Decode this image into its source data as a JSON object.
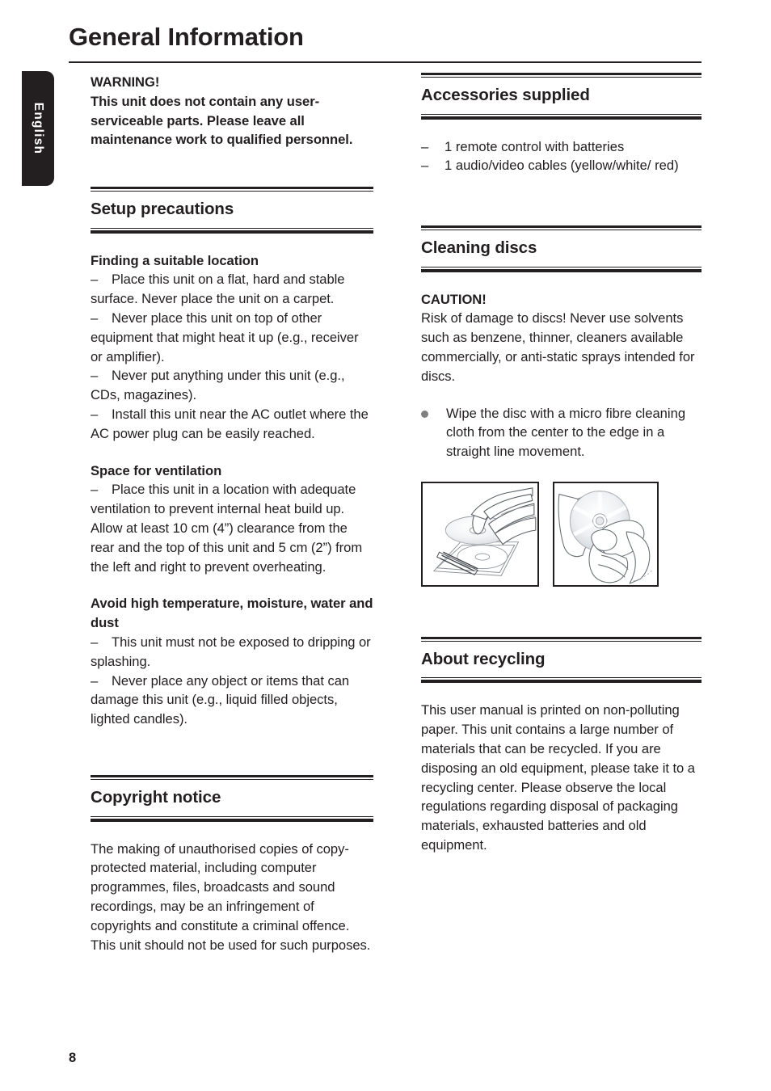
{
  "page": {
    "title": "General Information",
    "number": "8",
    "language_tab": "English"
  },
  "left_column": {
    "warning": {
      "heading": "WARNING!",
      "text": "This unit does not contain any user-serviceable parts. Please leave all maintenance work to qualified personnel."
    },
    "setup_precautions": {
      "title": "Setup precautions",
      "subsections": [
        {
          "heading": "Finding a suitable location",
          "items": [
            "Place this unit on a flat, hard and stable surface. Never place the unit on a carpet.",
            "Never place this unit on top of other equipment that might heat it up (e.g., receiver or amplifier).",
            "Never put anything under this unit (e.g., CDs, magazines).",
            "Install this unit near the AC outlet where the AC power plug can be easily reached."
          ]
        },
        {
          "heading": "Space for ventilation",
          "items": [
            "Place this unit in a location with adequate ventilation to prevent internal heat build up. Allow at least 10 cm (4”) clearance from the rear and the top of this unit and 5 cm (2”) from the left and right to prevent overheating."
          ]
        },
        {
          "heading": "Avoid high temperature, moisture, water and dust",
          "items": [
            "This unit must not be exposed to dripping or splashing.",
            "Never place any object or items that can damage this unit (e.g., liquid filled objects, lighted candles)."
          ]
        }
      ]
    },
    "copyright_notice": {
      "title": "Copyright notice",
      "text": "The making of unauthorised copies of copy-protected material, including computer programmes, files, broadcasts and sound recordings, may be an infringement of copyrights and constitute a criminal offence. This unit should not be used for such purposes."
    }
  },
  "right_column": {
    "accessories_supplied": {
      "title": "Accessories supplied",
      "items": [
        "1 remote control with batteries",
        "1 audio/video cables (yellow/white/ red)"
      ]
    },
    "cleaning_discs": {
      "title": "Cleaning discs",
      "caution_heading": "CAUTION!",
      "caution_text": "Risk of damage to discs! Never use solvents such as benzene, thinner, cleaners available commercially, or anti-static sprays intended for discs.",
      "bullet": "Wipe the disc with a micro fibre cleaning cloth from the center to the edge in a straight line movement.",
      "figures": [
        {
          "name": "disc-removal-from-case-illustration"
        },
        {
          "name": "disc-wiping-with-cloth-illustration"
        }
      ]
    },
    "about_recycling": {
      "title": "About recycling",
      "text": "This user manual is printed on non-polluting paper. This unit contains a large number of materials that can be recycled. If you are disposing an old equipment, please take it to a recycling center. Please observe the local regulations regarding disposal of packaging materials, exhausted batteries and old equipment."
    }
  },
  "symbols": {
    "dash": "–",
    "bullet_color": "#808080"
  }
}
